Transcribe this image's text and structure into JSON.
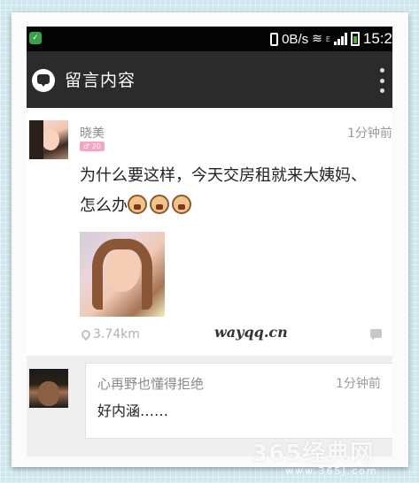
{
  "status_bar": {
    "speed": "0B/s",
    "network": "E",
    "time": "15:2"
  },
  "app_bar": {
    "title": "留言内容"
  },
  "post": {
    "username": "晓美",
    "level": "20",
    "time": "1分钟前",
    "text_line1": "为什么要这样，今天交房租就来大姨妈、",
    "text_line2": "怎么办",
    "emoji_count": 3,
    "distance": "3.74km",
    "watermark": "wayqq.cn"
  },
  "reply": {
    "username": "心再野也懂得拒绝",
    "time": "1分钟前",
    "text": "好内涵……"
  },
  "site_watermark": {
    "name": "365经典网",
    "url": "www.365J.com"
  },
  "colors": {
    "app_bar": "#2b2b2b",
    "status_bar": "#050505",
    "badge": "#f4a5c4",
    "background": "#cfe8ee"
  }
}
